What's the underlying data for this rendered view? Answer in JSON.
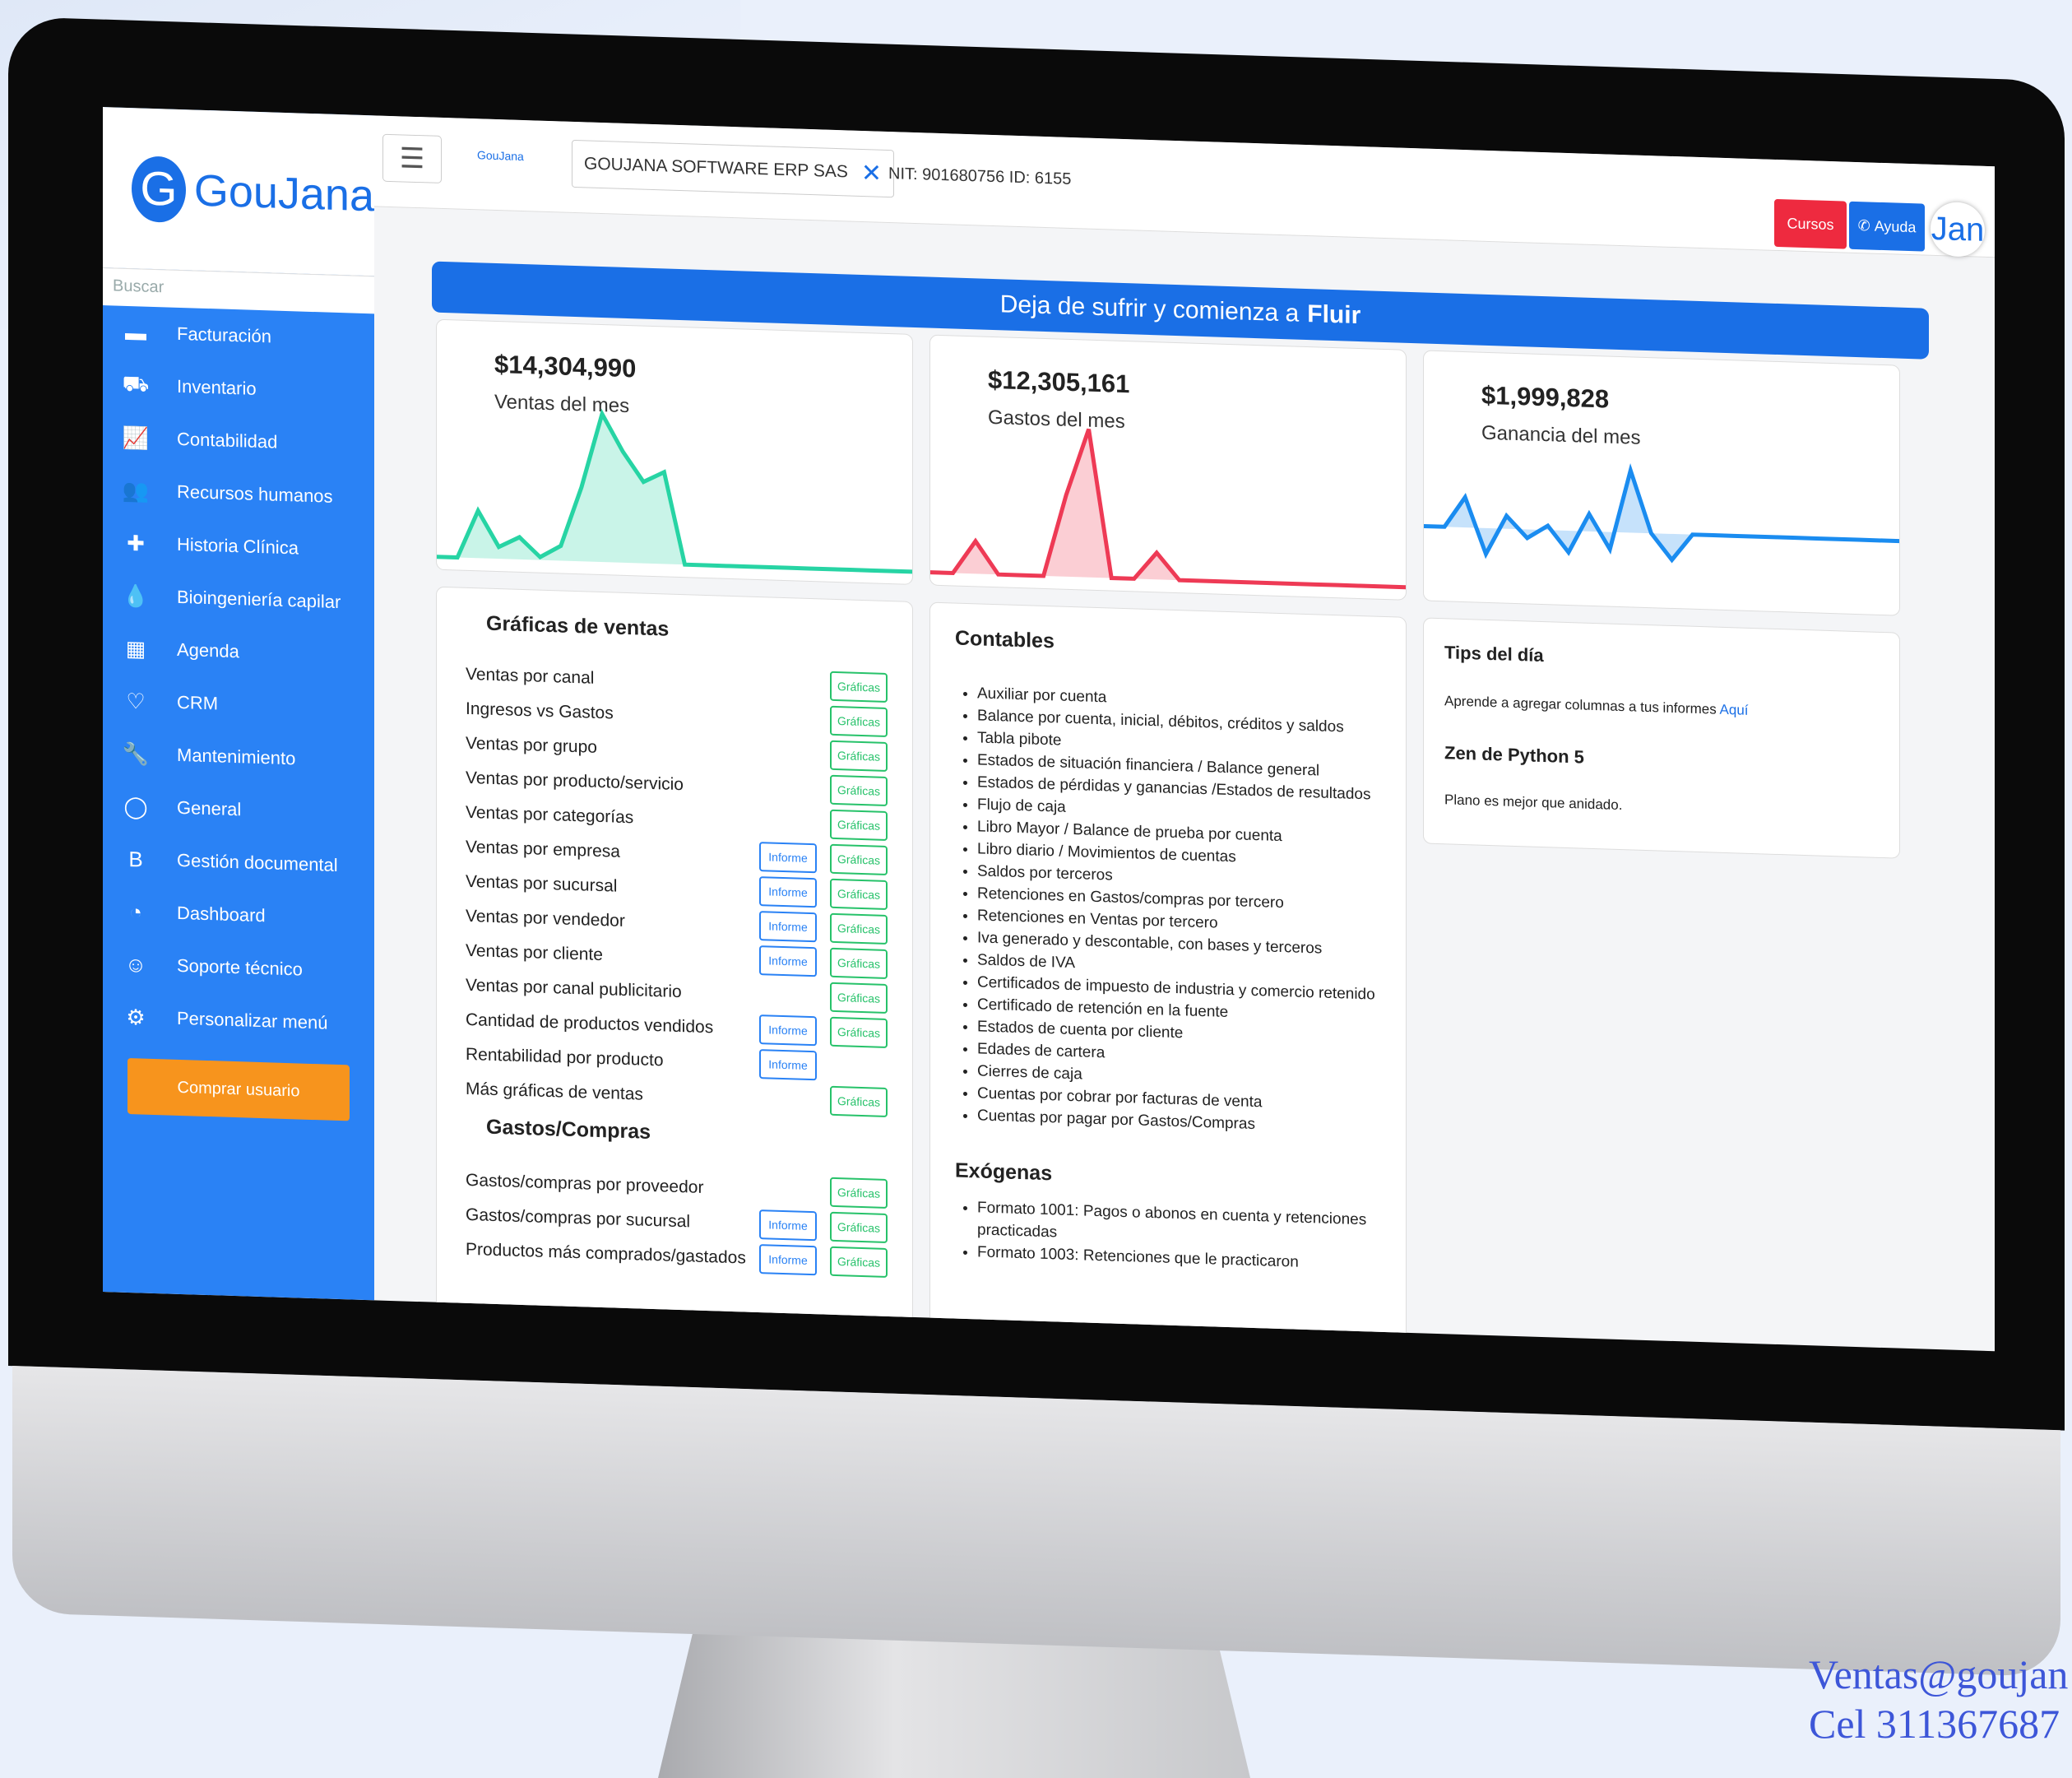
{
  "sidebar": {
    "logo": "GouJana",
    "search_placeholder": "Buscar",
    "items": [
      {
        "label": "Facturación",
        "icon": "credit-card-icon",
        "glyph": "▬"
      },
      {
        "label": "Inventario",
        "icon": "truck-icon",
        "glyph": "⛟"
      },
      {
        "label": "Contabilidad",
        "icon": "chart-line-icon",
        "glyph": "📈"
      },
      {
        "label": "Recursos humanos",
        "icon": "users-icon",
        "glyph": "👥"
      },
      {
        "label": "Historia Clínica",
        "icon": "medical-plus-icon",
        "glyph": "✚"
      },
      {
        "label": "Bioingeniería capilar",
        "icon": "droplet-icon",
        "glyph": "💧"
      },
      {
        "label": "Agenda",
        "icon": "calendar-icon",
        "glyph": "▦"
      },
      {
        "label": "CRM",
        "icon": "heart-icon",
        "glyph": "♡"
      },
      {
        "label": "Mantenimiento",
        "icon": "wrench-icon",
        "glyph": "🔧"
      },
      {
        "label": "General",
        "icon": "circle-notch-icon",
        "glyph": "◯"
      },
      {
        "label": "Gestión documental",
        "icon": "blog-icon",
        "glyph": "B"
      },
      {
        "label": "Dashboard",
        "icon": "gauge-icon",
        "glyph": "◔"
      },
      {
        "label": "Soporte técnico",
        "icon": "support-agent-icon",
        "glyph": "☺"
      },
      {
        "label": "Personalizar menú",
        "icon": "cogs-icon",
        "glyph": "⚙"
      }
    ],
    "buy_button": "Comprar usuario"
  },
  "topbar": {
    "mini_logo": "GouJana",
    "company": "GOUJANA SOFTWARE ERP SAS",
    "nit": "NIT: 901680756 ID: 6155",
    "cursos": "Cursos",
    "ayuda": "Ayuda",
    "user_initials": "Jan"
  },
  "banner": {
    "text": "Deja de sufrir y comienza a",
    "bold": "Fluir"
  },
  "kpis": [
    {
      "amount": "$14,304,990",
      "label": "Ventas del mes",
      "color": "#27d4a4",
      "values": [
        0,
        0,
        0.32,
        0.08,
        0.15,
        0.02,
        0.1,
        0.5,
        1.0,
        0.75,
        0.55,
        0.62,
        0,
        0,
        0,
        0,
        0,
        0,
        0,
        0,
        0,
        0,
        0,
        0
      ]
    },
    {
      "amount": "$12,305,161",
      "label": "Gastos del mes",
      "color": "#ee3a55",
      "values": [
        0,
        0,
        0.22,
        0,
        0,
        0,
        0.55,
        1.0,
        0,
        0,
        0.18,
        0,
        0,
        0,
        0,
        0,
        0,
        0,
        0,
        0,
        0,
        0
      ]
    },
    {
      "amount": "$1,999,828",
      "label": "Ganancia del mes",
      "color": "#1a8cf0",
      "values": [
        0,
        0,
        0.35,
        -0.3,
        0.15,
        -0.1,
        0.05,
        -0.25,
        0.2,
        -0.2,
        0.72,
        0,
        -0.3,
        0,
        0,
        0,
        0,
        0,
        0,
        0,
        0,
        0,
        0,
        0
      ]
    }
  ],
  "ventas": {
    "title": "Gráficas de ventas",
    "informe_label": "Informe",
    "graficas_label": "Gráficas",
    "rows": [
      {
        "label": "Ventas por canal",
        "informe": false,
        "graficas": true
      },
      {
        "label": "Ingresos vs Gastos",
        "informe": false,
        "graficas": true
      },
      {
        "label": "Ventas por grupo",
        "informe": false,
        "graficas": true
      },
      {
        "label": "Ventas por producto/servicio",
        "informe": false,
        "graficas": true
      },
      {
        "label": "Ventas por categorías",
        "informe": false,
        "graficas": true
      },
      {
        "label": "Ventas por empresa",
        "informe": true,
        "graficas": true
      },
      {
        "label": "Ventas por sucursal",
        "informe": true,
        "graficas": true
      },
      {
        "label": "Ventas por vendedor",
        "informe": true,
        "graficas": true
      },
      {
        "label": "Ventas por cliente",
        "informe": true,
        "graficas": true
      },
      {
        "label": "Ventas por canal publicitario",
        "informe": false,
        "graficas": true
      },
      {
        "label": "Cantidad de productos vendidos",
        "informe": true,
        "graficas": true
      },
      {
        "label": "Rentabilidad por producto",
        "informe": true,
        "graficas": false
      },
      {
        "label": "Más gráficas de ventas",
        "informe": false,
        "graficas": true
      }
    ],
    "gastos_title": "Gastos/Compras",
    "gastos_rows": [
      {
        "label": "Gastos/compras por proveedor",
        "informe": false,
        "graficas": true
      },
      {
        "label": "Gastos/compras por sucursal",
        "informe": true,
        "graficas": true
      },
      {
        "label": "Productos más comprados/gastados",
        "informe": true,
        "graficas": true
      }
    ]
  },
  "contables": {
    "title": "Contables",
    "items": [
      "Auxiliar por cuenta",
      "Balance por cuenta, inicial, débitos, créditos y saldos",
      "Tabla pibote",
      "Estados de situación financiera / Balance general",
      "Estados de pérdidas y ganancias /Estados de resultados",
      "Flujo de caja",
      "Libro Mayor / Balance de prueba por cuenta",
      "Libro diario / Movimientos de cuentas",
      "Saldos por terceros",
      "Retenciones en Gastos/compras por tercero",
      "Retenciones en Ventas por tercero",
      "Iva generado y descontable, con bases y terceros",
      "Saldos de IVA",
      "Certificados de impuesto de industria y comercio retenido",
      "Certificado de retención en la fuente",
      "Estados de cuenta por cliente",
      "Edades de cartera",
      "Cierres de caja",
      "Cuentas por cobrar por facturas de venta",
      "Cuentas por pagar por Gastos/Compras"
    ],
    "exogenas_title": "Exógenas",
    "exogenas": [
      "Formato 1001: Pagos o abonos en cuenta y retenciones practicadas",
      "Formato 1003: Retenciones que le practicaron"
    ]
  },
  "tips": {
    "title": "Tips del día",
    "text": "Aprende a agregar columnas a tus informes",
    "link": "Aquí",
    "zen_title": "Zen de Python 5",
    "zen_text": "Plano es mejor que anidado."
  },
  "footer": {
    "email": "Ventas@goujan",
    "phone": "Cel 311367687"
  }
}
